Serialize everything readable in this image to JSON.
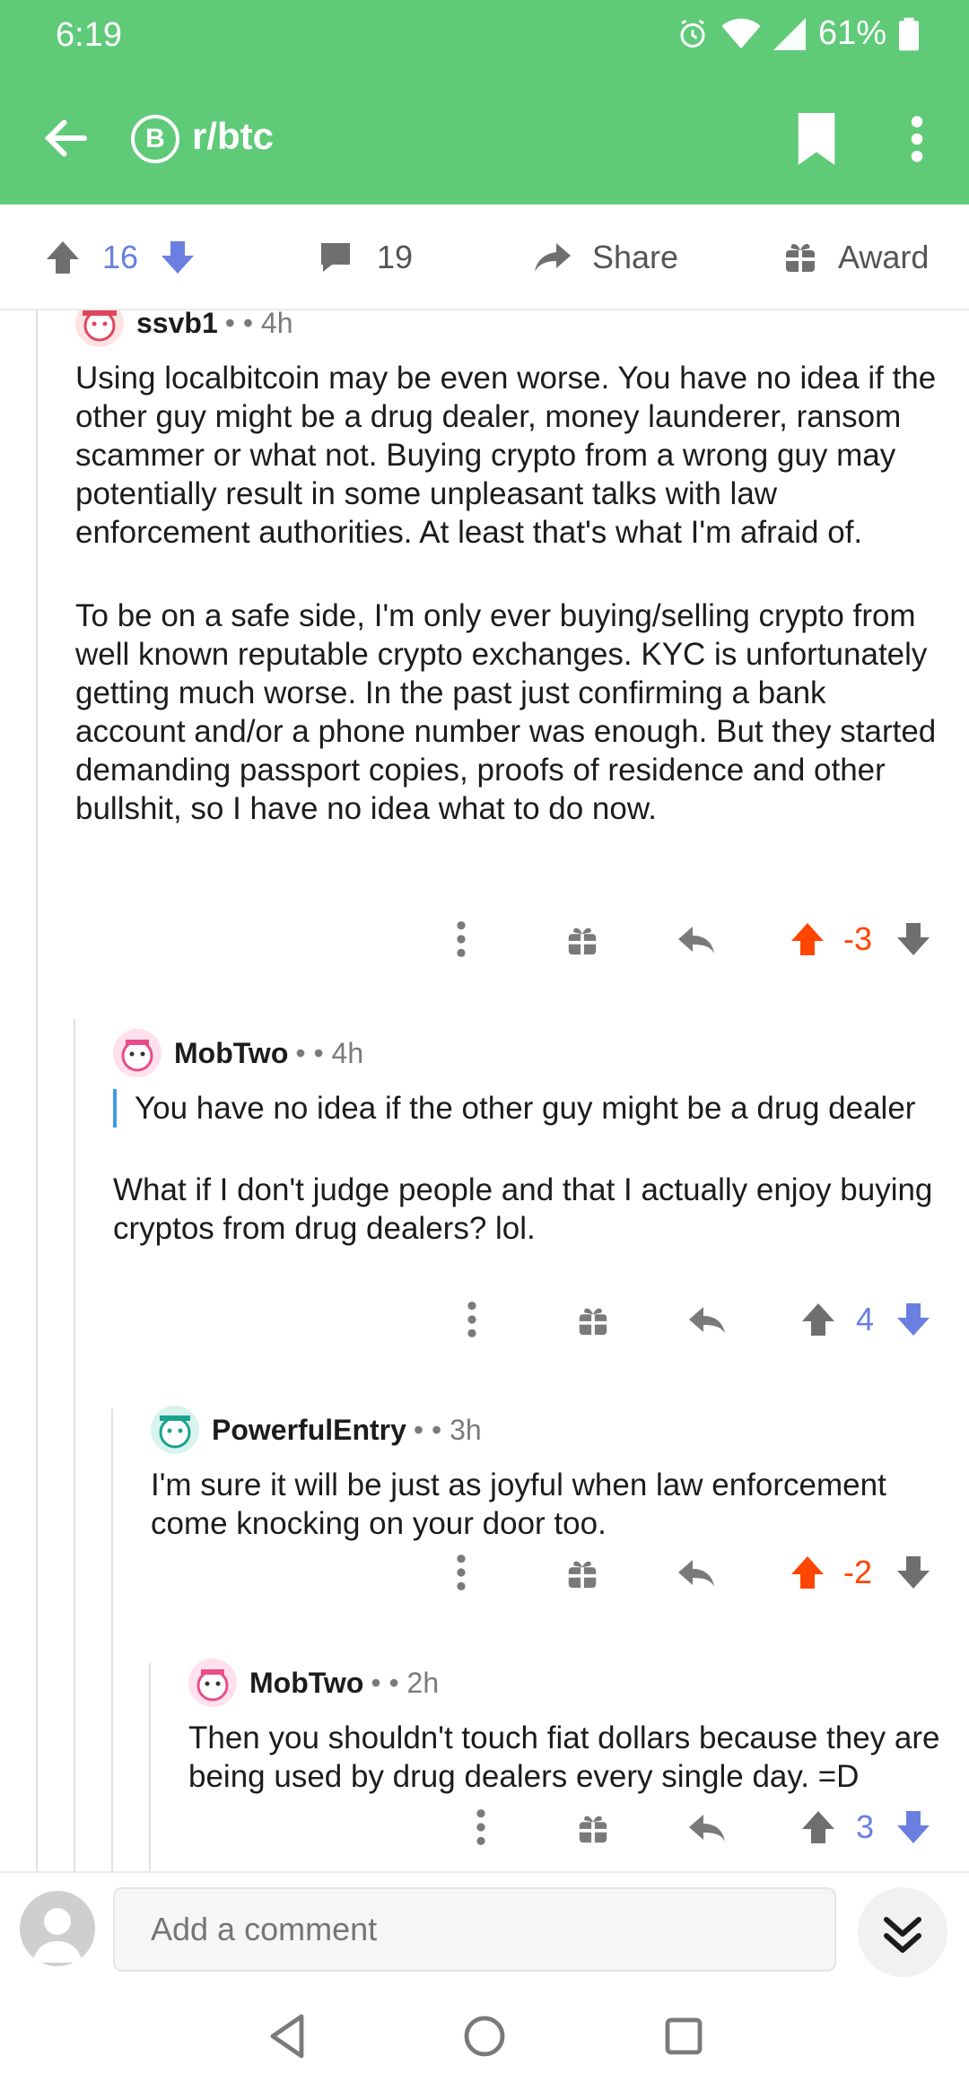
{
  "status": {
    "time": "6:19",
    "battery": "61%"
  },
  "toolbar": {
    "subreddit": "r/btc",
    "sub_icon": "B"
  },
  "post_actions": {
    "score": "16",
    "comments": "19",
    "share": "Share",
    "award": "Award"
  },
  "comments": [
    {
      "author": "ssvb1",
      "meta": "• • 4h",
      "paragraphs": [
        "Using localbitcoin may be even worse. You have no idea if the other guy might be a drug dealer, money launderer, ransom scammer or what not. Buying crypto from a wrong guy may potentially result in some unpleasant talks with law enforcement authorities. At least that's what I'm afraid of.",
        "To be on a safe side, I'm only ever buying/selling crypto from well known reputable crypto exchanges. KYC is unfortunately getting much worse. In the past just confirming a bank account and/or a phone number was enough. But they started demanding passport copies, proofs of residence and other bullshit, so I have no idea what to do now."
      ],
      "score": "-3"
    },
    {
      "author": "MobTwo",
      "meta": "• • 4h",
      "quote": "You have no idea if the other guy might be a drug dealer",
      "paragraphs": [
        "What if I don't judge people and that I actually enjoy buying cryptos from drug dealers? lol."
      ],
      "score": "4"
    },
    {
      "author": "PowerfulEntry",
      "meta": "• • 3h",
      "paragraphs": [
        "I'm sure it will be just as joyful when law enforcement come knocking on your door too."
      ],
      "score": "-2"
    },
    {
      "author": "MobTwo",
      "meta": "• • 2h",
      "paragraphs": [
        "Then you shouldn't touch fiat dollars because they are being used by drug dealers every single day. =D"
      ],
      "score": "3"
    }
  ],
  "compose": {
    "placeholder": "Add a comment"
  },
  "colors": {
    "brand": "#5fca78",
    "upvote": "#ff4500",
    "downvote": "#6a7fe0",
    "quote_bar": "#3d9de4"
  }
}
